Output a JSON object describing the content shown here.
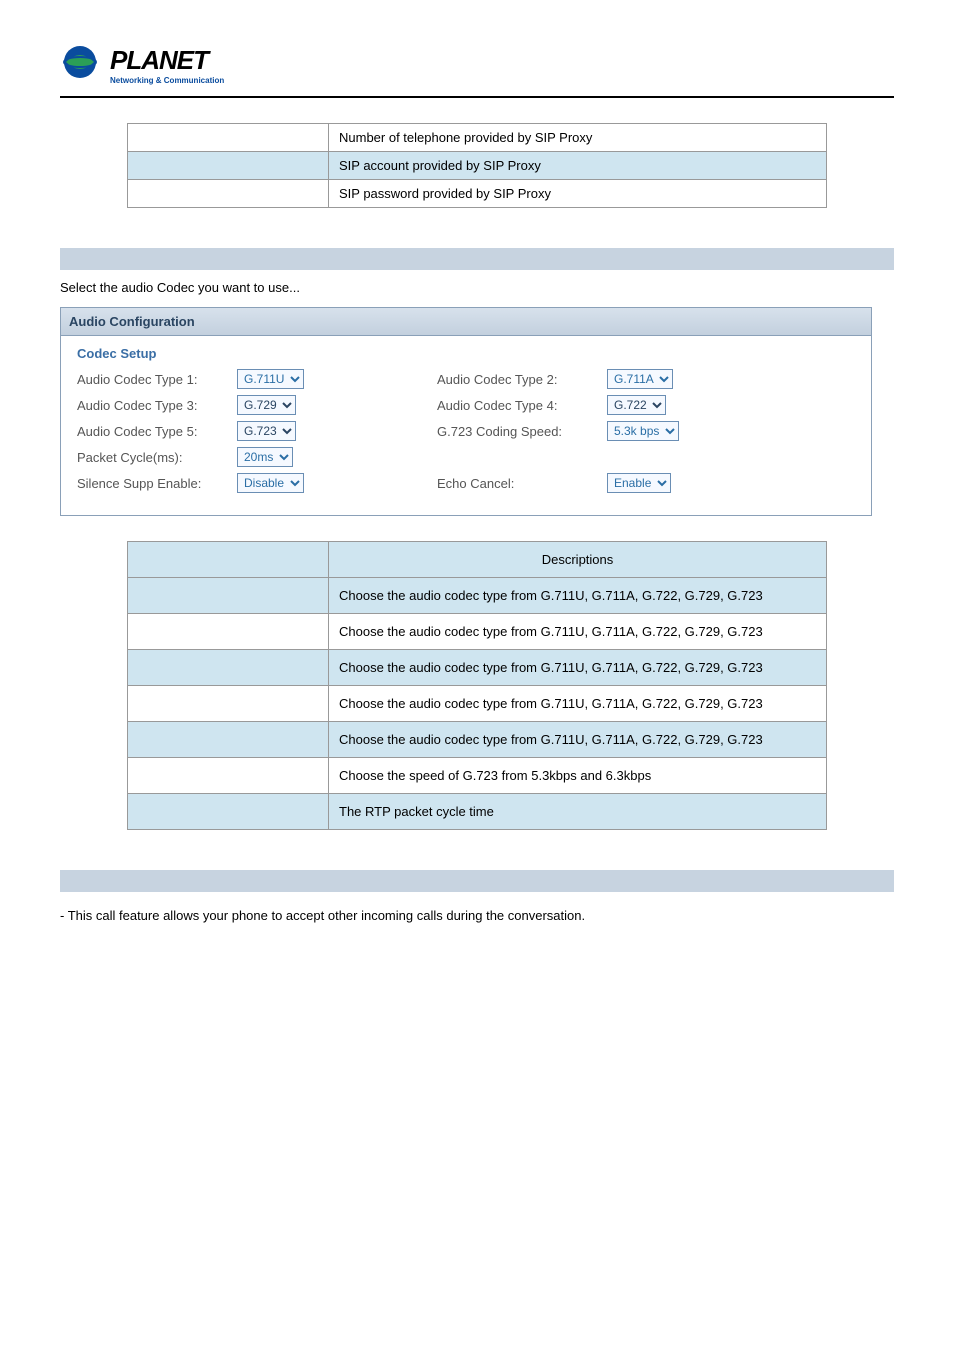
{
  "logo": {
    "brand": "PLANET",
    "tagline": "Networking & Communication"
  },
  "topTable": {
    "rows": [
      {
        "left": "",
        "right": "Number of telephone provided by SIP Proxy",
        "highlight": false
      },
      {
        "left": "",
        "right": "SIP account provided by SIP Proxy",
        "highlight": true
      },
      {
        "left": "",
        "right": "SIP password provided by SIP Proxy",
        "highlight": false
      }
    ]
  },
  "audio": {
    "intro": "Select the audio Codec you want to use...",
    "panelTitle": "Audio Configuration",
    "fieldsetLabel": "Codec Setup",
    "fields": {
      "type1": {
        "label": "Audio Codec Type 1:",
        "value": "G.711U"
      },
      "type2": {
        "label": "Audio Codec Type 2:",
        "value": "G.711A"
      },
      "type3": {
        "label": "Audio Codec Type 3:",
        "value": "G.729"
      },
      "type4": {
        "label": "Audio Codec Type 4:",
        "value": "G.722"
      },
      "type5": {
        "label": "Audio Codec Type 5:",
        "value": "G.723"
      },
      "g723speed": {
        "label": "G.723 Coding Speed:",
        "value": "5.3k bps"
      },
      "packetCycle": {
        "label": "Packet Cycle(ms):",
        "value": "20ms"
      },
      "silenceSupp": {
        "label": "Silence Supp Enable:",
        "value": "Disable"
      },
      "echoCancel": {
        "label": "Echo Cancel:",
        "value": "Enable"
      }
    }
  },
  "descTable": {
    "header": {
      "left": "",
      "right": "Descriptions"
    },
    "rows": [
      {
        "left": "",
        "right": "Choose the audio codec type from G.711U, G.711A, G.722, G.729, G.723",
        "highlight": true
      },
      {
        "left": "",
        "right": "Choose the audio codec type from G.711U, G.711A, G.722, G.729, G.723",
        "highlight": false
      },
      {
        "left": "",
        "right": "Choose the audio codec type from G.711U, G.711A, G.722, G.729, G.723",
        "highlight": true
      },
      {
        "left": "",
        "right": "Choose the audio codec type from G.711U, G.711A, G.722, G.729, G.723",
        "highlight": false
      },
      {
        "left": "",
        "right": "Choose the audio codec type from G.711U, G.711A, G.722, G.729, G.723",
        "highlight": true
      },
      {
        "left": "",
        "right": "Choose the speed of G.723 from 5.3kbps and 6.3kbps",
        "highlight": false
      },
      {
        "left": "",
        "right": "The RTP packet cycle time",
        "highlight": true
      }
    ]
  },
  "footerText": " - This call feature allows your phone to accept other incoming calls during the conversation."
}
